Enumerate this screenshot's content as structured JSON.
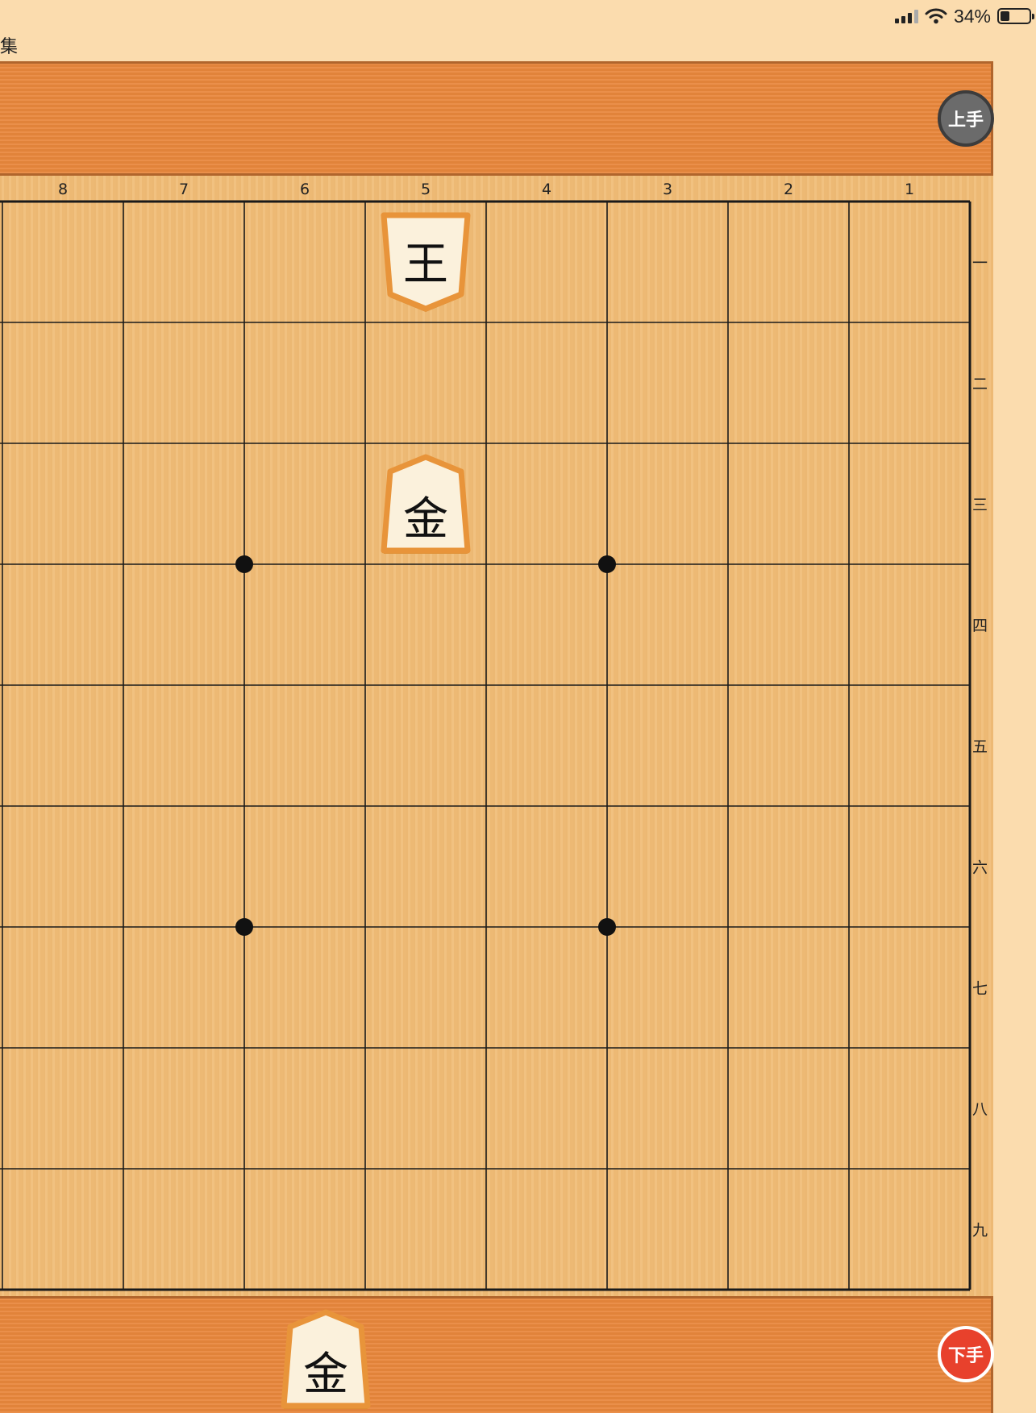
{
  "status_bar": {
    "battery_percent": "34%",
    "battery_level": 0.34,
    "wifi_icon": "wifi-icon",
    "signal_icon": "cellular-signal-icon"
  },
  "corner_text": "集",
  "players": {
    "gote": {
      "label": "上手",
      "color": "#6b6b6b"
    },
    "sente": {
      "label": "下手",
      "color": "#e8412c"
    }
  },
  "board": {
    "file_labels": [
      "8",
      "7",
      "6",
      "5",
      "4",
      "3",
      "2",
      "1"
    ],
    "rank_labels": [
      "一",
      "二",
      "三",
      "四",
      "五",
      "六",
      "七",
      "八",
      "九"
    ],
    "star_points": [
      [
        "6",
        "三"
      ],
      [
        "3",
        "三"
      ],
      [
        "6",
        "六"
      ],
      [
        "3",
        "六"
      ]
    ],
    "pieces": [
      {
        "label": "王",
        "file": 5,
        "rank": 1,
        "owner": "gote"
      },
      {
        "label": "金",
        "file": 5,
        "rank": 3,
        "owner": "sente"
      }
    ]
  },
  "hand_sente": [
    {
      "label": "金",
      "count": 1
    }
  ],
  "hand_gote": []
}
